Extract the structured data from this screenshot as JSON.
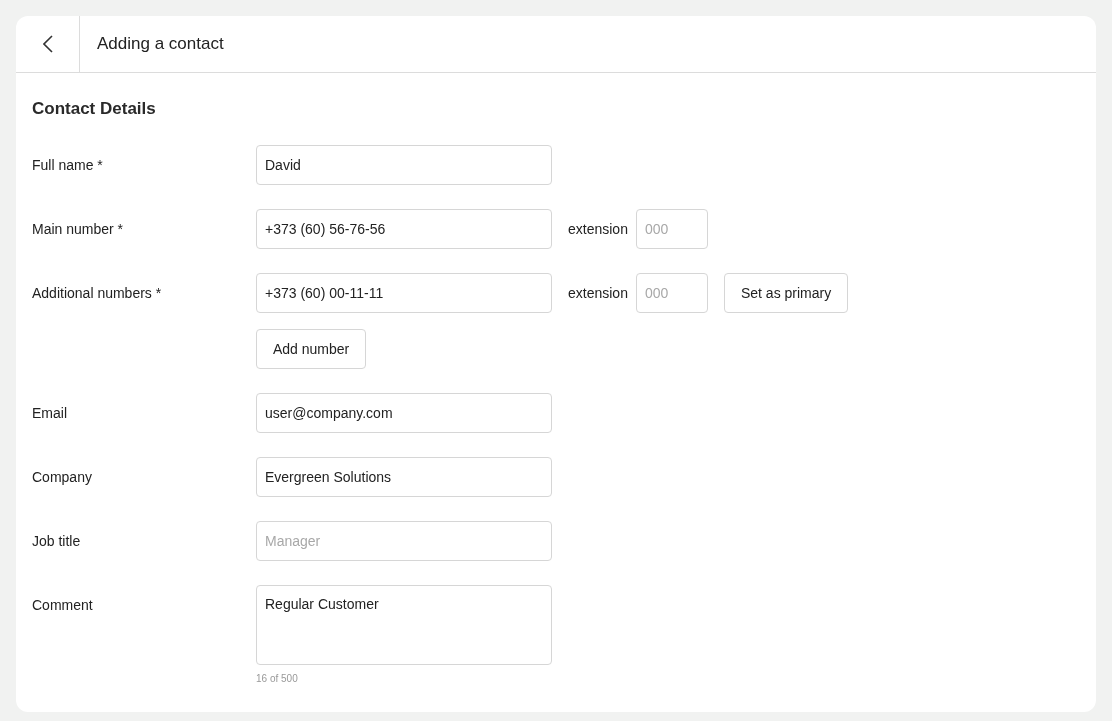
{
  "header": {
    "title": "Adding a contact"
  },
  "section": {
    "title": "Contact Details"
  },
  "fields": [
    {
      "kind": "text",
      "label": "Full name *",
      "value": "David"
    },
    {
      "kind": "phone",
      "label": "Main number *",
      "value": "+373 (60) 56-76-56",
      "extension_label": "extension",
      "extension_placeholder": "000"
    },
    {
      "kind": "phone",
      "label": "Additional numbers *",
      "value": "+373 (60) 00-11-11",
      "extension_label": "extension",
      "extension_placeholder": "000",
      "action": "Set as primary",
      "add_button": "Add number"
    },
    {
      "kind": "text",
      "label": "Email",
      "value": "user@company.com"
    },
    {
      "kind": "text",
      "label": "Company",
      "value": "Evergreen Solutions"
    },
    {
      "kind": "text",
      "label": "Job title",
      "placeholder": "Manager"
    },
    {
      "kind": "textarea",
      "label": "Comment",
      "value": "Regular Customer",
      "counter": "16 of 500"
    }
  ]
}
